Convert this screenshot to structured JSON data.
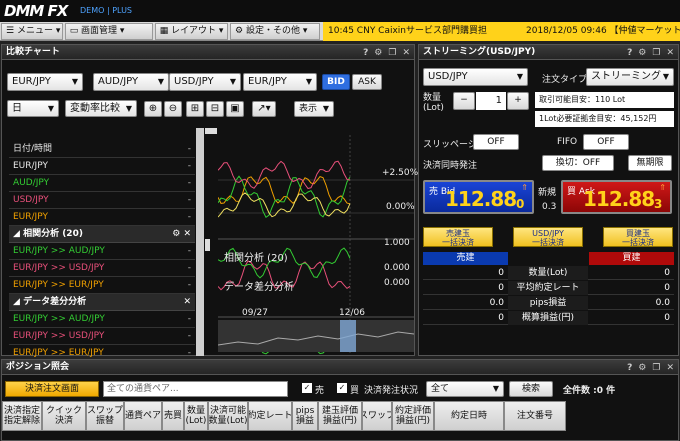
{
  "app": {
    "logo": "DMM FX",
    "logo_sub": "DEMO | PLUS"
  },
  "menubar": {
    "menu": "メニュー",
    "screen": "画面管理",
    "layout": "レイアウト",
    "settings": "設定・その他"
  },
  "ticker": {
    "text": "10:45 CNY Caixinサービス部門購買担",
    "datetime": "2018/12/05 09:46 【仲値マーケットプ"
  },
  "compare": {
    "title": "比較チャート",
    "pairs": [
      "EUR/JPY",
      "AUD/JPY",
      "USD/JPY",
      "EUR/JPY"
    ],
    "bid": "BID",
    "ask": "ASK",
    "period": "日",
    "mode": "変動率比較",
    "display": "表示",
    "rows": [
      {
        "label": "日付/時間",
        "value": "-",
        "color": "#e8e8e8"
      },
      {
        "label": "EUR/JPY",
        "value": "-",
        "color": "#e8e8e8"
      },
      {
        "label": "AUD/JPY",
        "value": "-",
        "color": "#33cc33"
      },
      {
        "label": "USD/JPY",
        "value": "-",
        "color": "#e8507a"
      },
      {
        "label": "EUR/JPY",
        "value": "-",
        "color": "#f0a000"
      }
    ],
    "corr_title": "相関分析 (20)",
    "corr_rows": [
      {
        "label": "EUR/JPY >> AUD/JPY",
        "value": "-",
        "color": "#33cc33"
      },
      {
        "label": "EUR/JPY >> USD/JPY",
        "value": "-",
        "color": "#e8507a"
      },
      {
        "label": "EUR/JPY >> EUR/JPY",
        "value": "-",
        "color": "#f0a000"
      }
    ],
    "diff_title": "データ差分分析",
    "diff_rows": [
      {
        "label": "EUR/JPY >> AUD/JPY",
        "value": "-",
        "color": "#33cc33"
      },
      {
        "label": "EUR/JPY >> USD/JPY",
        "value": "-",
        "color": "#e8507a"
      },
      {
        "label": "EUR/JPY >> EUR/JPY",
        "value": "-",
        "color": "#f0a000"
      }
    ],
    "yticks": [
      "+2.50%",
      "0.00%"
    ],
    "sub1": "相関分析 (20)",
    "sub1_ticks": [
      "1.000",
      "0.000"
    ],
    "sub2": "データ差分分析",
    "sub2_tick": "0.000",
    "xdates": [
      "09/27",
      "12/06"
    ]
  },
  "streaming": {
    "title": "ストリーミング(USD/JPY)",
    "pair": "USD/JPY",
    "order_type_label": "注文タイプ",
    "order_type": "ストリーミング",
    "qty_label": "数量(Lot)",
    "qty": "1",
    "minus": "−",
    "plus": "+",
    "avail": "取引可能目安：110 Lot",
    "margin": "1Lot必要証拠金目安：45,152円",
    "slippage_label": "スリッページ",
    "slippage": "OFF",
    "fifo_label": "FIFO",
    "fifo": "OFF",
    "simul_label": "決済同時発注",
    "switch": "換切：OFF",
    "unlimited": "無期限",
    "bid_label": "売 Bid",
    "bid_big": "112.88",
    "bid_small": "0",
    "spread_label": "新規",
    "spread": "0.3",
    "ask_label": "買 Ask",
    "ask_big": "112.88",
    "ask_small": "3",
    "btn_sell_all": "売建玉\n一括決済",
    "btn_pair_all": "USD/JPY\n一括決済",
    "btn_buy_all": "買建玉\n一括決済",
    "sell_hdr": "売建",
    "buy_hdr": "買建",
    "rows": [
      {
        "label": "数量(Lot)",
        "left": "0",
        "right": "0"
      },
      {
        "label": "平均約定レート",
        "left": "0",
        "right": "0"
      },
      {
        "label": "pips損益",
        "left": "0.0",
        "right": "0.0"
      },
      {
        "label": "概算損益(円)",
        "left": "0",
        "right": "0"
      }
    ]
  },
  "position": {
    "title": "ポジション照会",
    "settle_btn": "決済注文画面",
    "filter_placeholder": "全ての通貨ペア...",
    "sell_label": "売",
    "buy_label": "買",
    "status_label": "決済発注状況",
    "status_value": "全て",
    "search": "検索",
    "total": "全件数 :0 件",
    "headers": [
      "決済指定\n指定解除",
      "クイック\n決済",
      "スワップ\n振替",
      "通貨ペア",
      "売買",
      "数量\n(Lot)",
      "決済可能\n数量(Lot)",
      "約定レート",
      "pips\n損益",
      "建玉評価\n損益(円)",
      "スワップ",
      "約定評価\n損益(円)",
      "約定日時",
      "注文番号"
    ]
  }
}
